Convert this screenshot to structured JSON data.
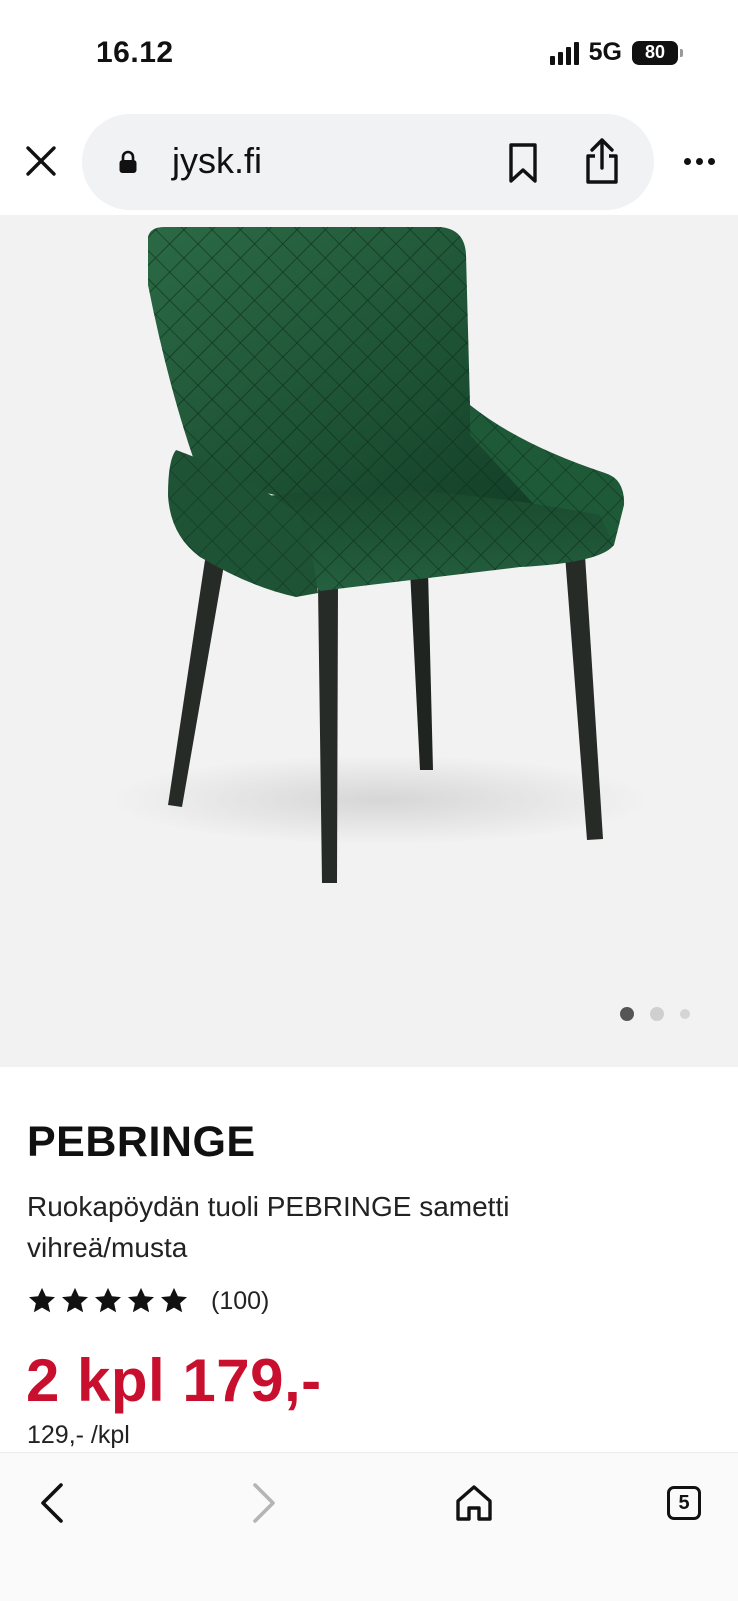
{
  "status_bar": {
    "time": "16.12",
    "network": "5G",
    "battery": "80"
  },
  "browser": {
    "url": "jysk.fi"
  },
  "gallery": {
    "image_count": 3,
    "active_index": 0,
    "image_alt": "Ruokapöydän tuoli PEBRINGE samametti vihreä/musta",
    "colors": {
      "dot_active": "#555555",
      "dot_inactive": "#cfcfcf",
      "background": "#f2f2f2"
    }
  },
  "product": {
    "name": "PEBRINGE",
    "description": "Ruokapöydän tuoli PEBRINGE sametti vihreä/musta",
    "rating": 5,
    "rating_max": 5,
    "review_count": "(100)",
    "price": "2 kpl 179,-",
    "unit_price": "129,- /kpl",
    "colors": {
      "price": "#c8102e"
    }
  },
  "toolbar": {
    "tab_count": "5"
  }
}
